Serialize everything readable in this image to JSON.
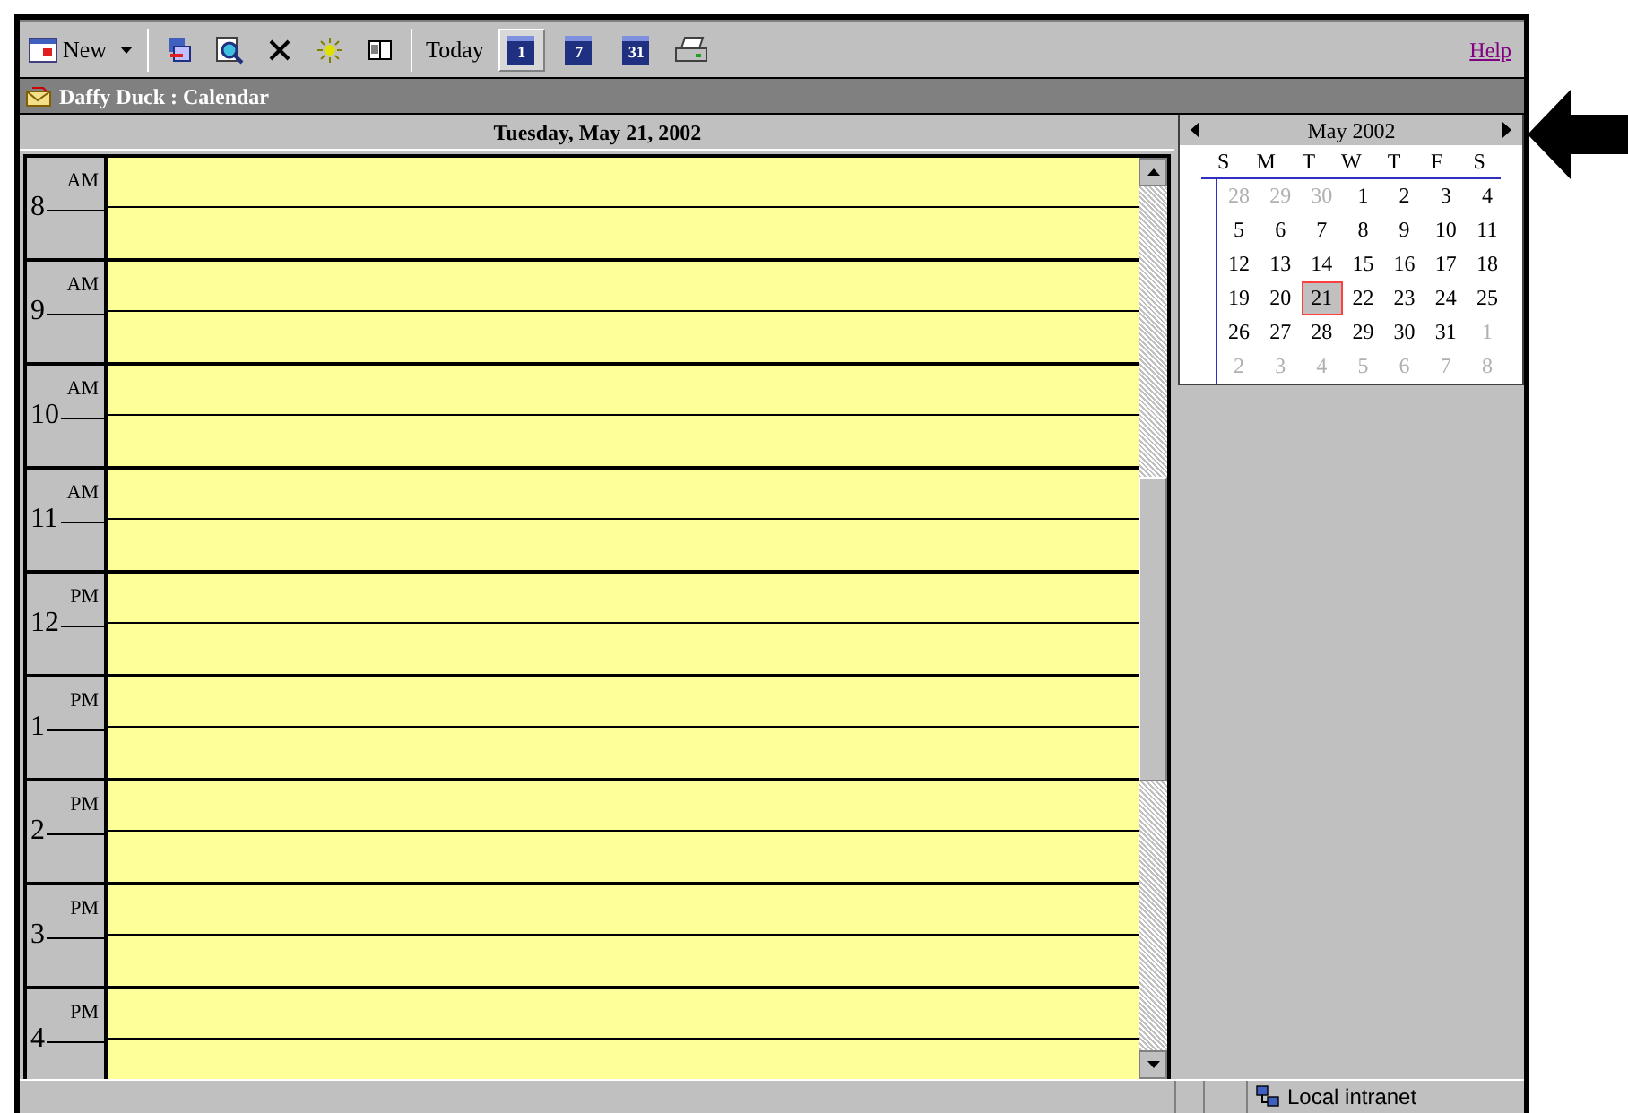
{
  "toolbar": {
    "new_label": "New",
    "today_label": "Today",
    "views": [
      {
        "label": "1",
        "selected": true
      },
      {
        "label": "7",
        "selected": false
      },
      {
        "label": "31",
        "selected": false
      }
    ],
    "help_link": "Help"
  },
  "title_bar": {
    "title": "Daffy Duck : Calendar"
  },
  "day_view": {
    "date": "Tuesday, May 21, 2002",
    "hours": [
      {
        "hour": "8",
        "period": "AM"
      },
      {
        "hour": "9",
        "period": "AM"
      },
      {
        "hour": "10",
        "period": "AM"
      },
      {
        "hour": "11",
        "period": "AM"
      },
      {
        "hour": "12",
        "period": "PM"
      },
      {
        "hour": "1",
        "period": "PM"
      },
      {
        "hour": "2",
        "period": "PM"
      },
      {
        "hour": "3",
        "period": "PM"
      },
      {
        "hour": "4",
        "period": "PM"
      }
    ]
  },
  "mini_calendar": {
    "month": "May 2002",
    "weekdays": [
      "S",
      "M",
      "T",
      "W",
      "T",
      "F",
      "S"
    ],
    "weeks": [
      [
        {
          "day": "28",
          "other_month": true,
          "selected": false
        },
        {
          "day": "29",
          "other_month": true,
          "selected": false
        },
        {
          "day": "30",
          "other_month": true,
          "selected": false
        },
        {
          "day": "1",
          "other_month": false,
          "selected": false
        },
        {
          "day": "2",
          "other_month": false,
          "selected": false
        },
        {
          "day": "3",
          "other_month": false,
          "selected": false
        },
        {
          "day": "4",
          "other_month": false,
          "selected": false
        }
      ],
      [
        {
          "day": "5",
          "other_month": false,
          "selected": false
        },
        {
          "day": "6",
          "other_month": false,
          "selected": false
        },
        {
          "day": "7",
          "other_month": false,
          "selected": false
        },
        {
          "day": "8",
          "other_month": false,
          "selected": false
        },
        {
          "day": "9",
          "other_month": false,
          "selected": false
        },
        {
          "day": "10",
          "other_month": false,
          "selected": false
        },
        {
          "day": "11",
          "other_month": false,
          "selected": false
        }
      ],
      [
        {
          "day": "12",
          "other_month": false,
          "selected": false
        },
        {
          "day": "13",
          "other_month": false,
          "selected": false
        },
        {
          "day": "14",
          "other_month": false,
          "selected": false
        },
        {
          "day": "15",
          "other_month": false,
          "selected": false
        },
        {
          "day": "16",
          "other_month": false,
          "selected": false
        },
        {
          "day": "17",
          "other_month": false,
          "selected": false
        },
        {
          "day": "18",
          "other_month": false,
          "selected": false
        }
      ],
      [
        {
          "day": "19",
          "other_month": false,
          "selected": false
        },
        {
          "day": "20",
          "other_month": false,
          "selected": false
        },
        {
          "day": "21",
          "other_month": false,
          "selected": true
        },
        {
          "day": "22",
          "other_month": false,
          "selected": false
        },
        {
          "day": "23",
          "other_month": false,
          "selected": false
        },
        {
          "day": "24",
          "other_month": false,
          "selected": false
        },
        {
          "day": "25",
          "other_month": false,
          "selected": false
        }
      ],
      [
        {
          "day": "26",
          "other_month": false,
          "selected": false
        },
        {
          "day": "27",
          "other_month": false,
          "selected": false
        },
        {
          "day": "28",
          "other_month": false,
          "selected": false
        },
        {
          "day": "29",
          "other_month": false,
          "selected": false
        },
        {
          "day": "30",
          "other_month": false,
          "selected": false
        },
        {
          "day": "31",
          "other_month": false,
          "selected": false
        },
        {
          "day": "1",
          "other_month": true,
          "selected": false
        }
      ],
      [
        {
          "day": "2",
          "other_month": true,
          "selected": false
        },
        {
          "day": "3",
          "other_month": true,
          "selected": false
        },
        {
          "day": "4",
          "other_month": true,
          "selected": false
        },
        {
          "day": "5",
          "other_month": true,
          "selected": false
        },
        {
          "day": "6",
          "other_month": true,
          "selected": false
        },
        {
          "day": "7",
          "other_month": true,
          "selected": false
        },
        {
          "day": "8",
          "other_month": true,
          "selected": false
        }
      ]
    ]
  },
  "status_bar": {
    "zone": "Local intranet"
  }
}
